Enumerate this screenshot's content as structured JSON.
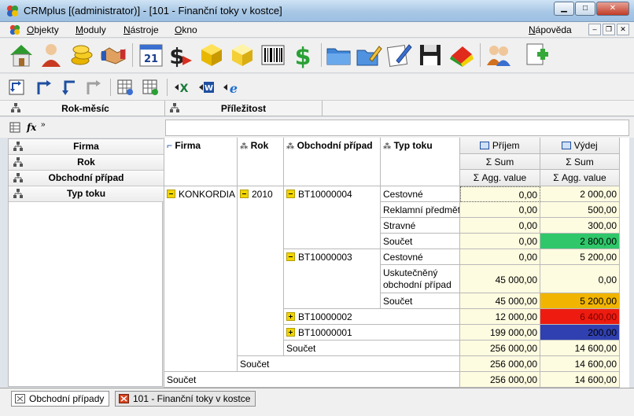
{
  "window": {
    "title": "CRMplus [(administrator)] - [101 - Finanční toky v kostce]"
  },
  "menu": {
    "items": [
      {
        "label": "Objekty",
        "hotkey": "O",
        "rest": "bjekty"
      },
      {
        "label": "Moduly",
        "hotkey": "M",
        "rest": "oduly"
      },
      {
        "label": "Nástroje",
        "hotkey": "N",
        "rest": "ástroje"
      },
      {
        "label": "Okno",
        "hotkey": "O",
        "rest": "kno"
      }
    ],
    "help": {
      "label": "Nápověda",
      "hotkey": "N",
      "rest": "ápověda"
    }
  },
  "pivot": {
    "column_fields": [
      "Rok-měsíc",
      "Příležitost"
    ],
    "row_fields": [
      "Firma",
      "Rok",
      "Obchodní případ",
      "Typ toku"
    ],
    "grid_headers": {
      "firma": "Firma",
      "rok": "Rok",
      "obchodni_pripad": "Obchodní případ",
      "typ_toku": "Typ toku"
    },
    "measures": {
      "prijem": "Příjem",
      "vydej": "Výdej",
      "sum": "Σ  Sum",
      "agg": "Σ  Agg. value"
    },
    "firma": "KONKORDIA",
    "year": "2010",
    "cases": {
      "c4": {
        "id": "BT10000004",
        "rows": [
          {
            "type": "Cestovné",
            "prijem": "0,00",
            "vydej": "2 000,00"
          },
          {
            "type": "Reklamní předměty",
            "prijem": "0,00",
            "vydej": "500,00"
          },
          {
            "type": "Stravné",
            "prijem": "0,00",
            "vydej": "300,00"
          },
          {
            "type": "Součet",
            "prijem": "0,00",
            "vydej": "2 800,00"
          }
        ]
      },
      "c3": {
        "id": "BT10000003",
        "rows": [
          {
            "type": "Cestovné",
            "prijem": "0,00",
            "vydej": "5 200,00"
          },
          {
            "type": "Uskutečněný obchodní případ",
            "prijem": "45 000,00",
            "vydej": "0,00"
          },
          {
            "type": "Součet",
            "prijem": "45 000,00",
            "vydej": "5 200,00"
          }
        ]
      },
      "c2": {
        "id": "BT10000002",
        "prijem": "12 000,00",
        "vydej": "6 400,00"
      },
      "c1": {
        "id": "BT10000001",
        "prijem": "199 000,00",
        "vydej": "200,00"
      }
    },
    "totals": {
      "label": "Součet",
      "year": {
        "prijem": "256 000,00",
        "vydej": "14 600,00"
      },
      "firma": {
        "prijem": "256 000,00",
        "vydej": "14 600,00"
      },
      "grand": {
        "prijem": "256 000,00",
        "vydej": "14 600,00"
      }
    }
  },
  "tabs": [
    {
      "label": "Obchodní případy",
      "icon": "cases-icon"
    },
    {
      "label": "101 - Finanční toky v kostce",
      "icon": "report-icon"
    }
  ],
  "colors": {
    "green": "#2fc76a",
    "orange": "#f1b400",
    "red": "#ee1c10",
    "blue": "#3040b0"
  }
}
